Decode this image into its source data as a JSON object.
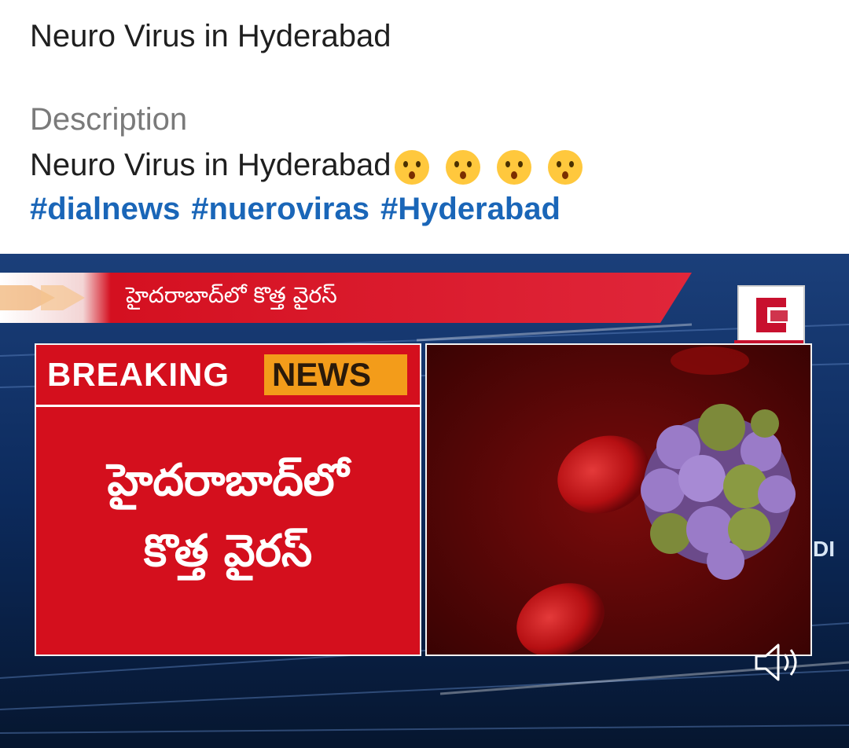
{
  "post": {
    "title": "Neuro Virus in Hyderabad",
    "description_heading": "Description",
    "description_text": "Neuro Virus in Hyderabad",
    "emojis": [
      "hushed-face-icon",
      "hushed-face-icon",
      "hushed-face-icon",
      "hushed-face-icon"
    ],
    "hashtags": [
      "#dialnews",
      "#nueroviras",
      "#Hyderabad"
    ]
  },
  "video": {
    "headline_telugu": "హైదరాబాద్‌లో కొత్త వైరస్",
    "channel_label": "DIAL NEWS",
    "breaking_word1": "BREAKING",
    "breaking_word2": "NEWS",
    "panel_line1": "హైదరాబాద్‌లో",
    "panel_line2": "కొత్త వైరస్",
    "side_text": "DI",
    "mute_icon": "speaker-muted-icon"
  },
  "colors": {
    "hashtag": "#1a66b8",
    "breaking_red": "#d40f1d",
    "news_orange": "#f39c1a",
    "background_blue": "#0a2450"
  }
}
